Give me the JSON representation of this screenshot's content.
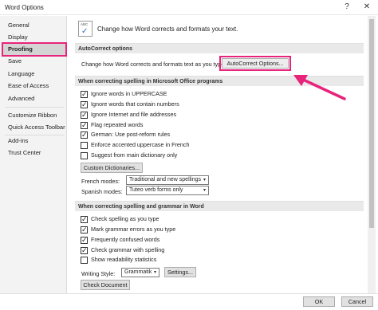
{
  "window": {
    "title": "Word Options",
    "help_glyph": "?",
    "close_glyph": "✕"
  },
  "sidebar": {
    "items": [
      {
        "label": "General"
      },
      {
        "label": "Display"
      },
      {
        "label": "Proofing",
        "active": true
      },
      {
        "label": "Save"
      },
      {
        "label": "Language"
      },
      {
        "label": "Ease of Access"
      },
      {
        "label": "Advanced"
      },
      {
        "label": "Customize Ribbon"
      },
      {
        "label": "Quick Access Toolbar"
      },
      {
        "label": "Add-ins"
      },
      {
        "label": "Trust Center"
      }
    ]
  },
  "header": {
    "icon_text": "ABC",
    "text": "Change how Word corrects and formats your text."
  },
  "autocorrect": {
    "section_title": "AutoCorrect options",
    "prompt": "Change how Word corrects and formats text as you type:",
    "button_label": "AutoCorrect Options..."
  },
  "office_spelling": {
    "section_title": "When correcting spelling in Microsoft Office programs",
    "options": [
      {
        "label": "Ignore words in UPPERCASE",
        "checked": true
      },
      {
        "label": "Ignore words that contain numbers",
        "checked": true
      },
      {
        "label": "Ignore Internet and file addresses",
        "checked": true
      },
      {
        "label": "Flag repeated words",
        "checked": true
      },
      {
        "label": "German: Use post-reform rules",
        "checked": true
      },
      {
        "label": "Enforce accented uppercase in French",
        "checked": false
      },
      {
        "label": "Suggest from main dictionary only",
        "checked": false
      }
    ],
    "custom_dictionaries_label": "Custom Dictionaries...",
    "french_modes_label": "French modes:",
    "french_modes_value": "Traditional and new spellings",
    "spanish_modes_label": "Spanish modes:",
    "spanish_modes_value": "Tuteo verb forms only"
  },
  "word_spelling": {
    "section_title": "When correcting spelling and grammar in Word",
    "options": [
      {
        "label": "Check spelling as you type",
        "checked": true
      },
      {
        "label": "Mark grammar errors as you type",
        "checked": true
      },
      {
        "label": "Frequently confused words",
        "checked": true
      },
      {
        "label": "Check grammar with spelling",
        "checked": true
      },
      {
        "label": "Show readability statistics",
        "checked": false
      }
    ],
    "writing_style_label": "Writing Style:",
    "writing_style_value": "Grammatik",
    "settings_label": "Settings...",
    "check_document_label": "Check Document"
  },
  "footer": {
    "ok_label": "OK",
    "cancel_label": "Cancel"
  },
  "colors": {
    "highlight": "#e8237c",
    "accent": "#2b6fb6"
  },
  "icons": {
    "checkmark": "✓",
    "caret": "▾"
  }
}
